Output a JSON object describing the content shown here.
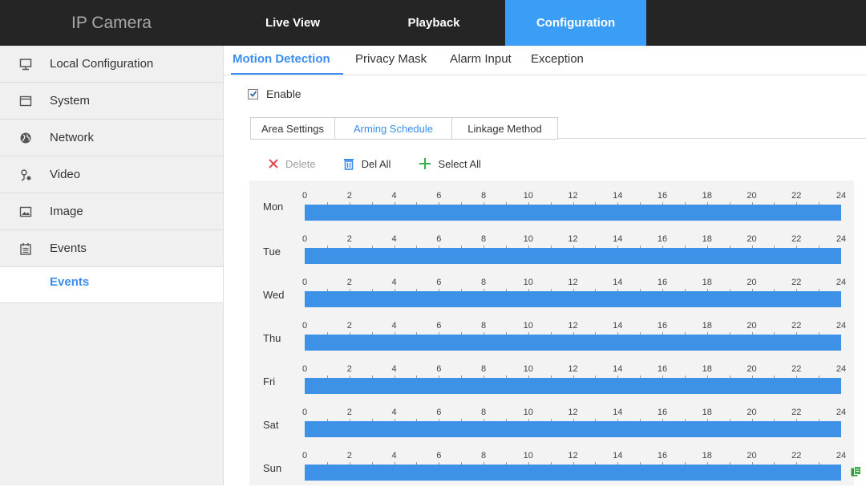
{
  "app_title": "IP Camera",
  "nav": [
    "Live View",
    "Playback",
    "Configuration"
  ],
  "sidebar": {
    "items": [
      {
        "label": "Local Configuration",
        "icon": "monitor-icon"
      },
      {
        "label": "System",
        "icon": "system-icon"
      },
      {
        "label": "Network",
        "icon": "globe-icon"
      },
      {
        "label": "Video",
        "icon": "video-icon"
      },
      {
        "label": "Image",
        "icon": "image-icon"
      },
      {
        "label": "Events",
        "icon": "calendar-icon"
      }
    ],
    "sub_item": "Events"
  },
  "tabs": [
    "Motion Detection",
    "Privacy Mask",
    "Alarm Input",
    "Exception"
  ],
  "enable_label": "Enable",
  "enable_checked": true,
  "steps": [
    "Area Settings",
    "Arming Schedule",
    "Linkage Method"
  ],
  "toolbar": {
    "delete": "Delete",
    "del_all": "Del All",
    "select_all": "Select All"
  },
  "schedule": {
    "days": [
      "Mon",
      "Tue",
      "Wed",
      "Thu",
      "Fri",
      "Sat",
      "Sun"
    ],
    "hour_labels": [
      "0",
      "2",
      "4",
      "6",
      "8",
      "10",
      "12",
      "14",
      "16",
      "18",
      "20",
      "22",
      "24"
    ],
    "armed_hours": [
      0,
      24
    ]
  },
  "colors": {
    "accent": "#3b9ef6",
    "bar": "#3d92e8",
    "topbar": "#252525"
  }
}
